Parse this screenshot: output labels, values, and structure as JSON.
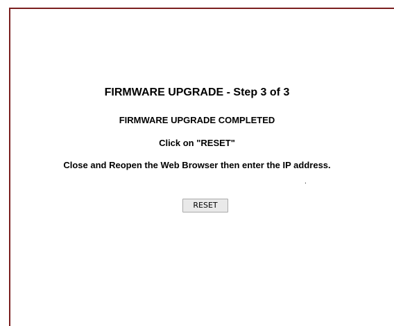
{
  "page": {
    "title": "FIRMWARE UPGRADE - Step 3 of 3",
    "status": "FIRMWARE UPGRADE COMPLETED",
    "click_instruction": "Click on \"RESET\"",
    "browser_instruction": "Close and Reopen the Web Browser then enter the IP address.",
    "dot": "."
  },
  "buttons": {
    "reset_label": "RESET"
  },
  "colors": {
    "frame_border": "#7a1e1e",
    "background": "#ffffff",
    "button_bg": "#e9e9e9"
  }
}
